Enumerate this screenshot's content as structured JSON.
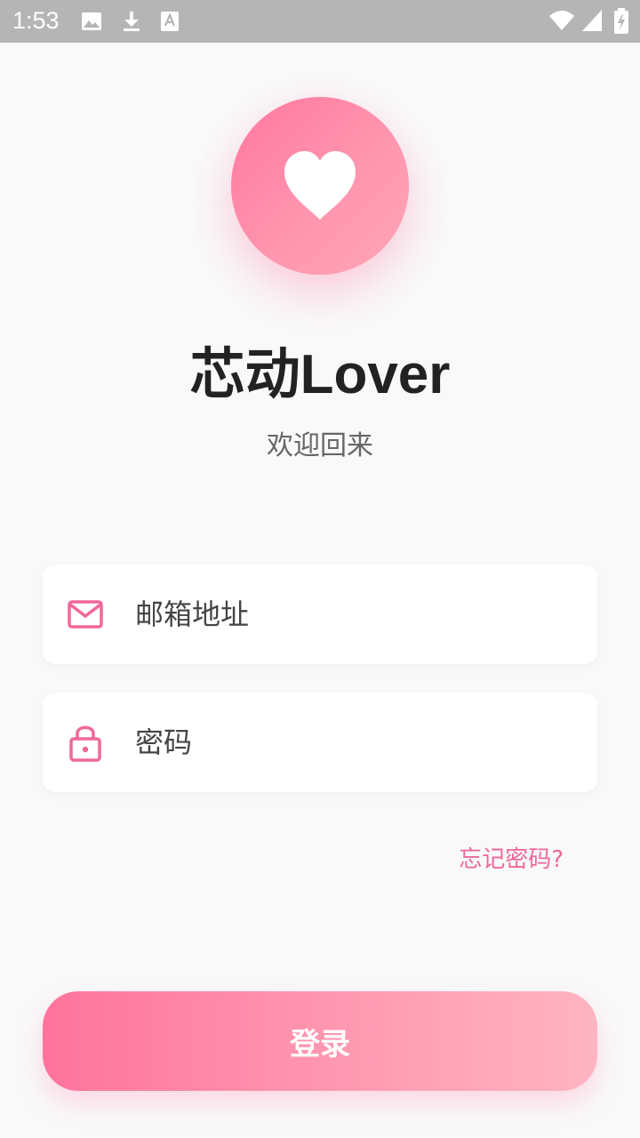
{
  "status_bar": {
    "time": "1:53",
    "left_icons": [
      "image-icon",
      "download-icon",
      "font-icon"
    ],
    "right_icons": [
      "wifi-icon",
      "signal-icon",
      "battery-charging-icon"
    ]
  },
  "header": {
    "logo_icon": "heart-icon",
    "title": "芯动Lover",
    "subtitle": "欢迎回来"
  },
  "form": {
    "email": {
      "icon": "mail-icon",
      "placeholder": "邮箱地址",
      "value": ""
    },
    "password": {
      "icon": "lock-icon",
      "placeholder": "密码",
      "value": ""
    },
    "forgot_label": "忘记密码?",
    "login_label": "登录"
  },
  "colors": {
    "accent": "#f0679a",
    "gradient_start": "#ff739d",
    "gradient_end": "#ffb4c1",
    "statusbar_bg": "#b5b5b5"
  }
}
